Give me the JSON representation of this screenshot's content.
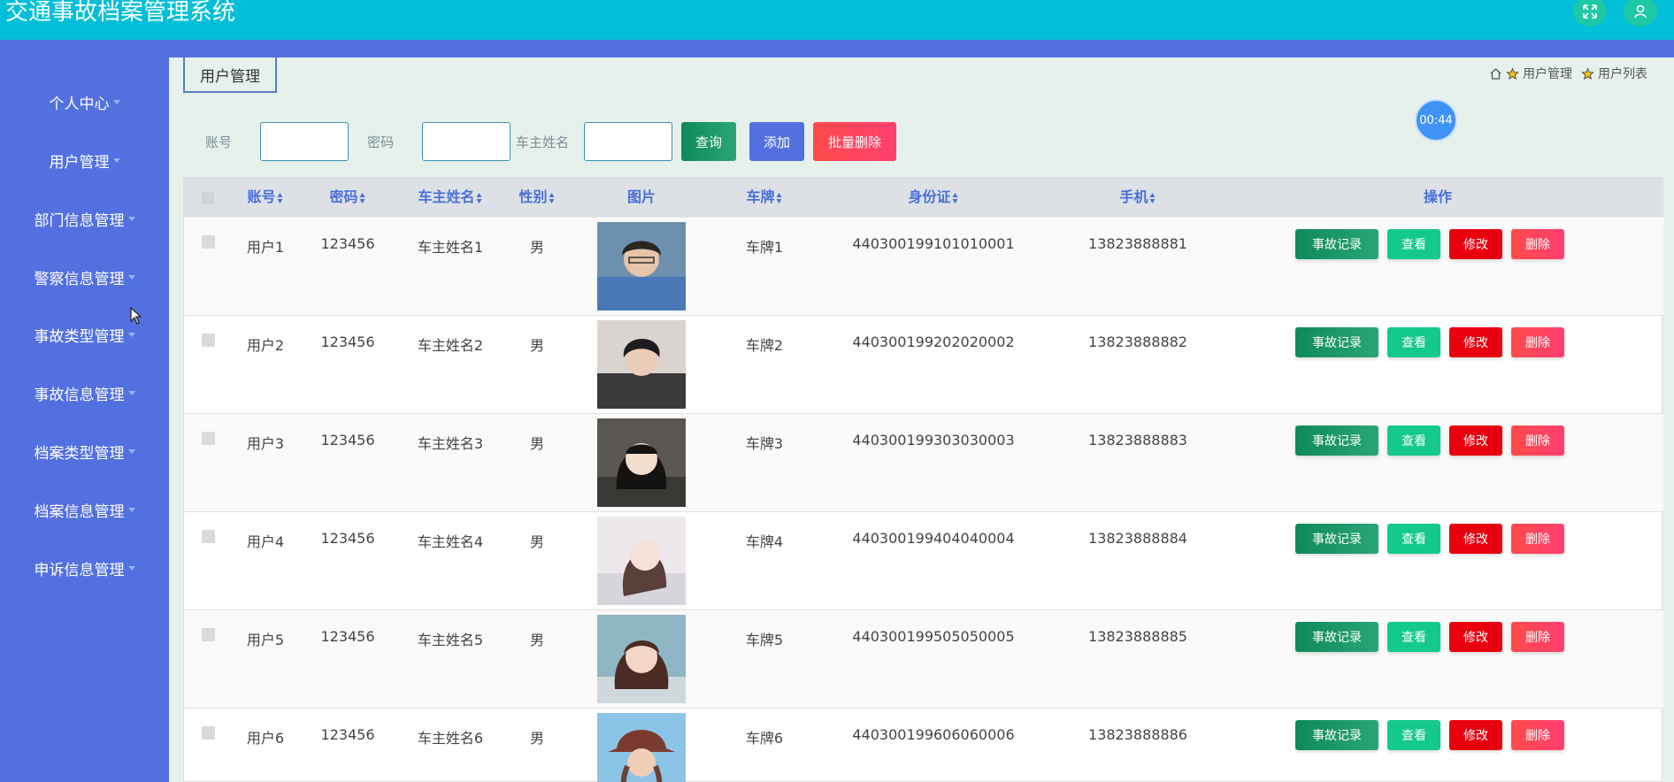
{
  "app": {
    "title": "交通事故档案管理系统"
  },
  "header": {
    "icons": [
      "fullscreen-icon",
      "user-icon"
    ]
  },
  "sidebar": {
    "items": [
      {
        "label": "个人中心"
      },
      {
        "label": "用户管理"
      },
      {
        "label": "部门信息管理"
      },
      {
        "label": "警察信息管理"
      },
      {
        "label": "事故类型管理"
      },
      {
        "label": "事故信息管理"
      },
      {
        "label": "档案类型管理"
      },
      {
        "label": "档案信息管理"
      },
      {
        "label": "申诉信息管理"
      }
    ]
  },
  "tab": {
    "label": "用户管理"
  },
  "breadcrumb": {
    "items": [
      "用户管理",
      "用户列表"
    ]
  },
  "timer": {
    "text": "00:44"
  },
  "filters": {
    "account_label": "账号",
    "password_label": "密码",
    "owner_label": "车主姓名",
    "account_value": "",
    "password_value": "",
    "owner_value": ""
  },
  "buttons": {
    "query": "查询",
    "add": "添加",
    "batch_delete": "批量删除"
  },
  "table": {
    "headers": {
      "account": "账号",
      "password": "密码",
      "owner": "车主姓名",
      "gender": "性别",
      "photo": "图片",
      "plate": "车牌",
      "id_card": "身份证",
      "phone": "手机",
      "actions": "操作"
    },
    "action_labels": {
      "record": "事故记录",
      "view": "查看",
      "edit": "修改",
      "delete": "删除"
    },
    "rows": [
      {
        "account": "用户1",
        "password": "123456",
        "owner": "车主姓名1",
        "gender": "男",
        "plate": "车牌1",
        "id_card": "440300199101010001",
        "phone": "13823888881"
      },
      {
        "account": "用户2",
        "password": "123456",
        "owner": "车主姓名2",
        "gender": "男",
        "plate": "车牌2",
        "id_card": "440300199202020002",
        "phone": "13823888882"
      },
      {
        "account": "用户3",
        "password": "123456",
        "owner": "车主姓名3",
        "gender": "男",
        "plate": "车牌3",
        "id_card": "440300199303030003",
        "phone": "13823888883"
      },
      {
        "account": "用户4",
        "password": "123456",
        "owner": "车主姓名4",
        "gender": "男",
        "plate": "车牌4",
        "id_card": "440300199404040004",
        "phone": "13823888884"
      },
      {
        "account": "用户5",
        "password": "123456",
        "owner": "车主姓名5",
        "gender": "男",
        "plate": "车牌5",
        "id_card": "440300199505050005",
        "phone": "13823888885"
      },
      {
        "account": "用户6",
        "password": "123456",
        "owner": "车主姓名6",
        "gender": "男",
        "plate": "车牌6",
        "id_card": "440300199606060006",
        "phone": "13823888886"
      }
    ]
  }
}
